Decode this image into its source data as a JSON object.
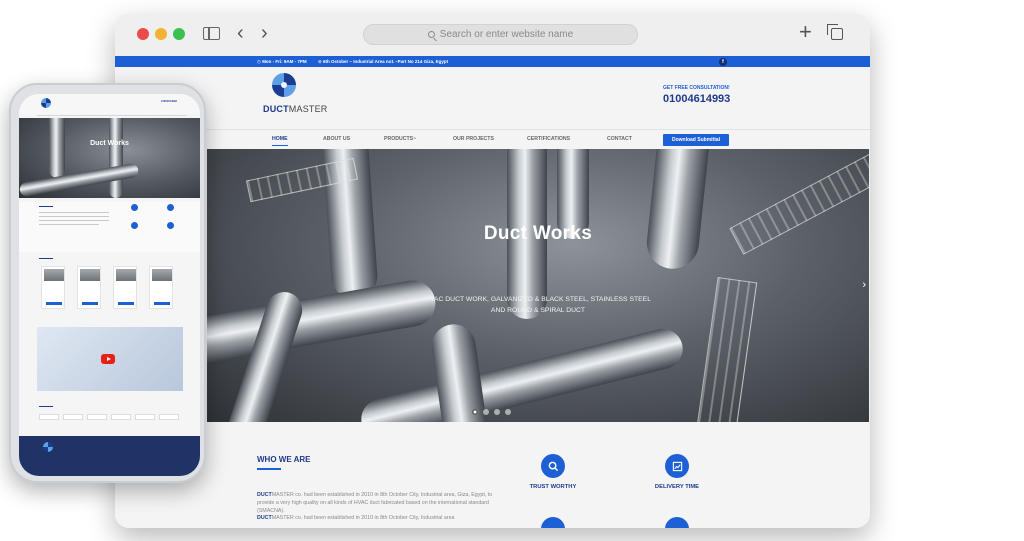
{
  "browser": {
    "address_placeholder": "Search or enter website name"
  },
  "site": {
    "topbar": {
      "hours": "Mon - Fri: 9AM - 7PM",
      "address": "6th October – Industrial Area no1 –Part No 214 Giza, Egypt",
      "social": "f"
    },
    "header": {
      "logo_bold": "DUCT",
      "logo_light": "MASTER",
      "consult_label": "GET FREE CONSULTATION!",
      "phone": "01004614993"
    },
    "nav": {
      "items": [
        "HOME",
        "ABOUT US",
        "PRODUCTS",
        "OUR PROJECTS",
        "CERTIFICATIONS",
        "CONTACT"
      ],
      "products_caret": "~",
      "cta": "Download Submittal"
    },
    "hero": {
      "title": "Duct Works",
      "subtitle_line1": "HVAC DUCT WORK, GALVANIZED & BLACK STEEL, STAINLESS STEEL",
      "subtitle_line2": "AND ROUND & SPIRAL DUCT",
      "next_arrow": "›",
      "slide_count": 4,
      "active_slide": 1
    },
    "who": {
      "title": "WHO WE ARE",
      "para1_bold": "DUCT",
      "para1_rest": "MASTER co. had been established in 2010 in 8th October City, Industrial area, Giza, Egypt, to provide a very high quality on all kinds of HVAC duct fabricated based on the international standard (SMACNA).",
      "para2_bold": "DUCT",
      "para2_rest": "MASTER co. had been established in 2010 in 8th October City, Industrial area",
      "features": [
        {
          "label": "TRUST WORTHY",
          "icon": "search-icon"
        },
        {
          "label": "DELIVERY TIME",
          "icon": "trend-chart-icon"
        }
      ]
    }
  },
  "mobile": {
    "hero_title": "Duct Works",
    "phone": "01004614993"
  },
  "colors": {
    "brand_blue": "#1d5fd4",
    "navy": "#1f3a8a",
    "footer": "#1f3366"
  }
}
